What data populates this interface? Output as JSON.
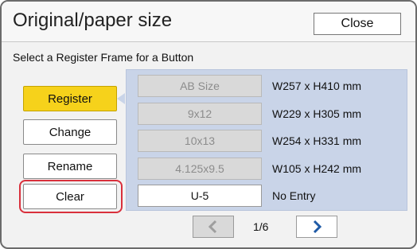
{
  "header": {
    "title": "Original/paper size",
    "close_label": "Close"
  },
  "subtitle": "Select a Register Frame for a Button",
  "actions": [
    {
      "label": "Register",
      "state": "active"
    },
    {
      "label": "Change",
      "state": "normal"
    },
    {
      "label": "Rename",
      "state": "normal"
    },
    {
      "label": "Clear",
      "state": "highlighted"
    }
  ],
  "sizes": [
    {
      "label": "AB Size",
      "dimensions": "W257 x H410 mm",
      "enabled": false
    },
    {
      "label": "9x12",
      "dimensions": "W229 x H305 mm",
      "enabled": false
    },
    {
      "label": "10x13",
      "dimensions": "W254 x H331 mm",
      "enabled": false
    },
    {
      "label": "4.125x9.5",
      "dimensions": "W105 x H242 mm",
      "enabled": false
    },
    {
      "label": "U-5",
      "dimensions": "No Entry",
      "enabled": true
    }
  ],
  "pager": {
    "current": "1/6"
  },
  "icons": {
    "prev": "chevron-left-icon",
    "next": "chevron-right-icon"
  },
  "colors": {
    "active_button": "#f6d21b",
    "panel": "#c9d4e8",
    "highlight": "#d9303c",
    "chevron_active": "#1f5aa6",
    "chevron_disabled": "#9e9e9e"
  }
}
